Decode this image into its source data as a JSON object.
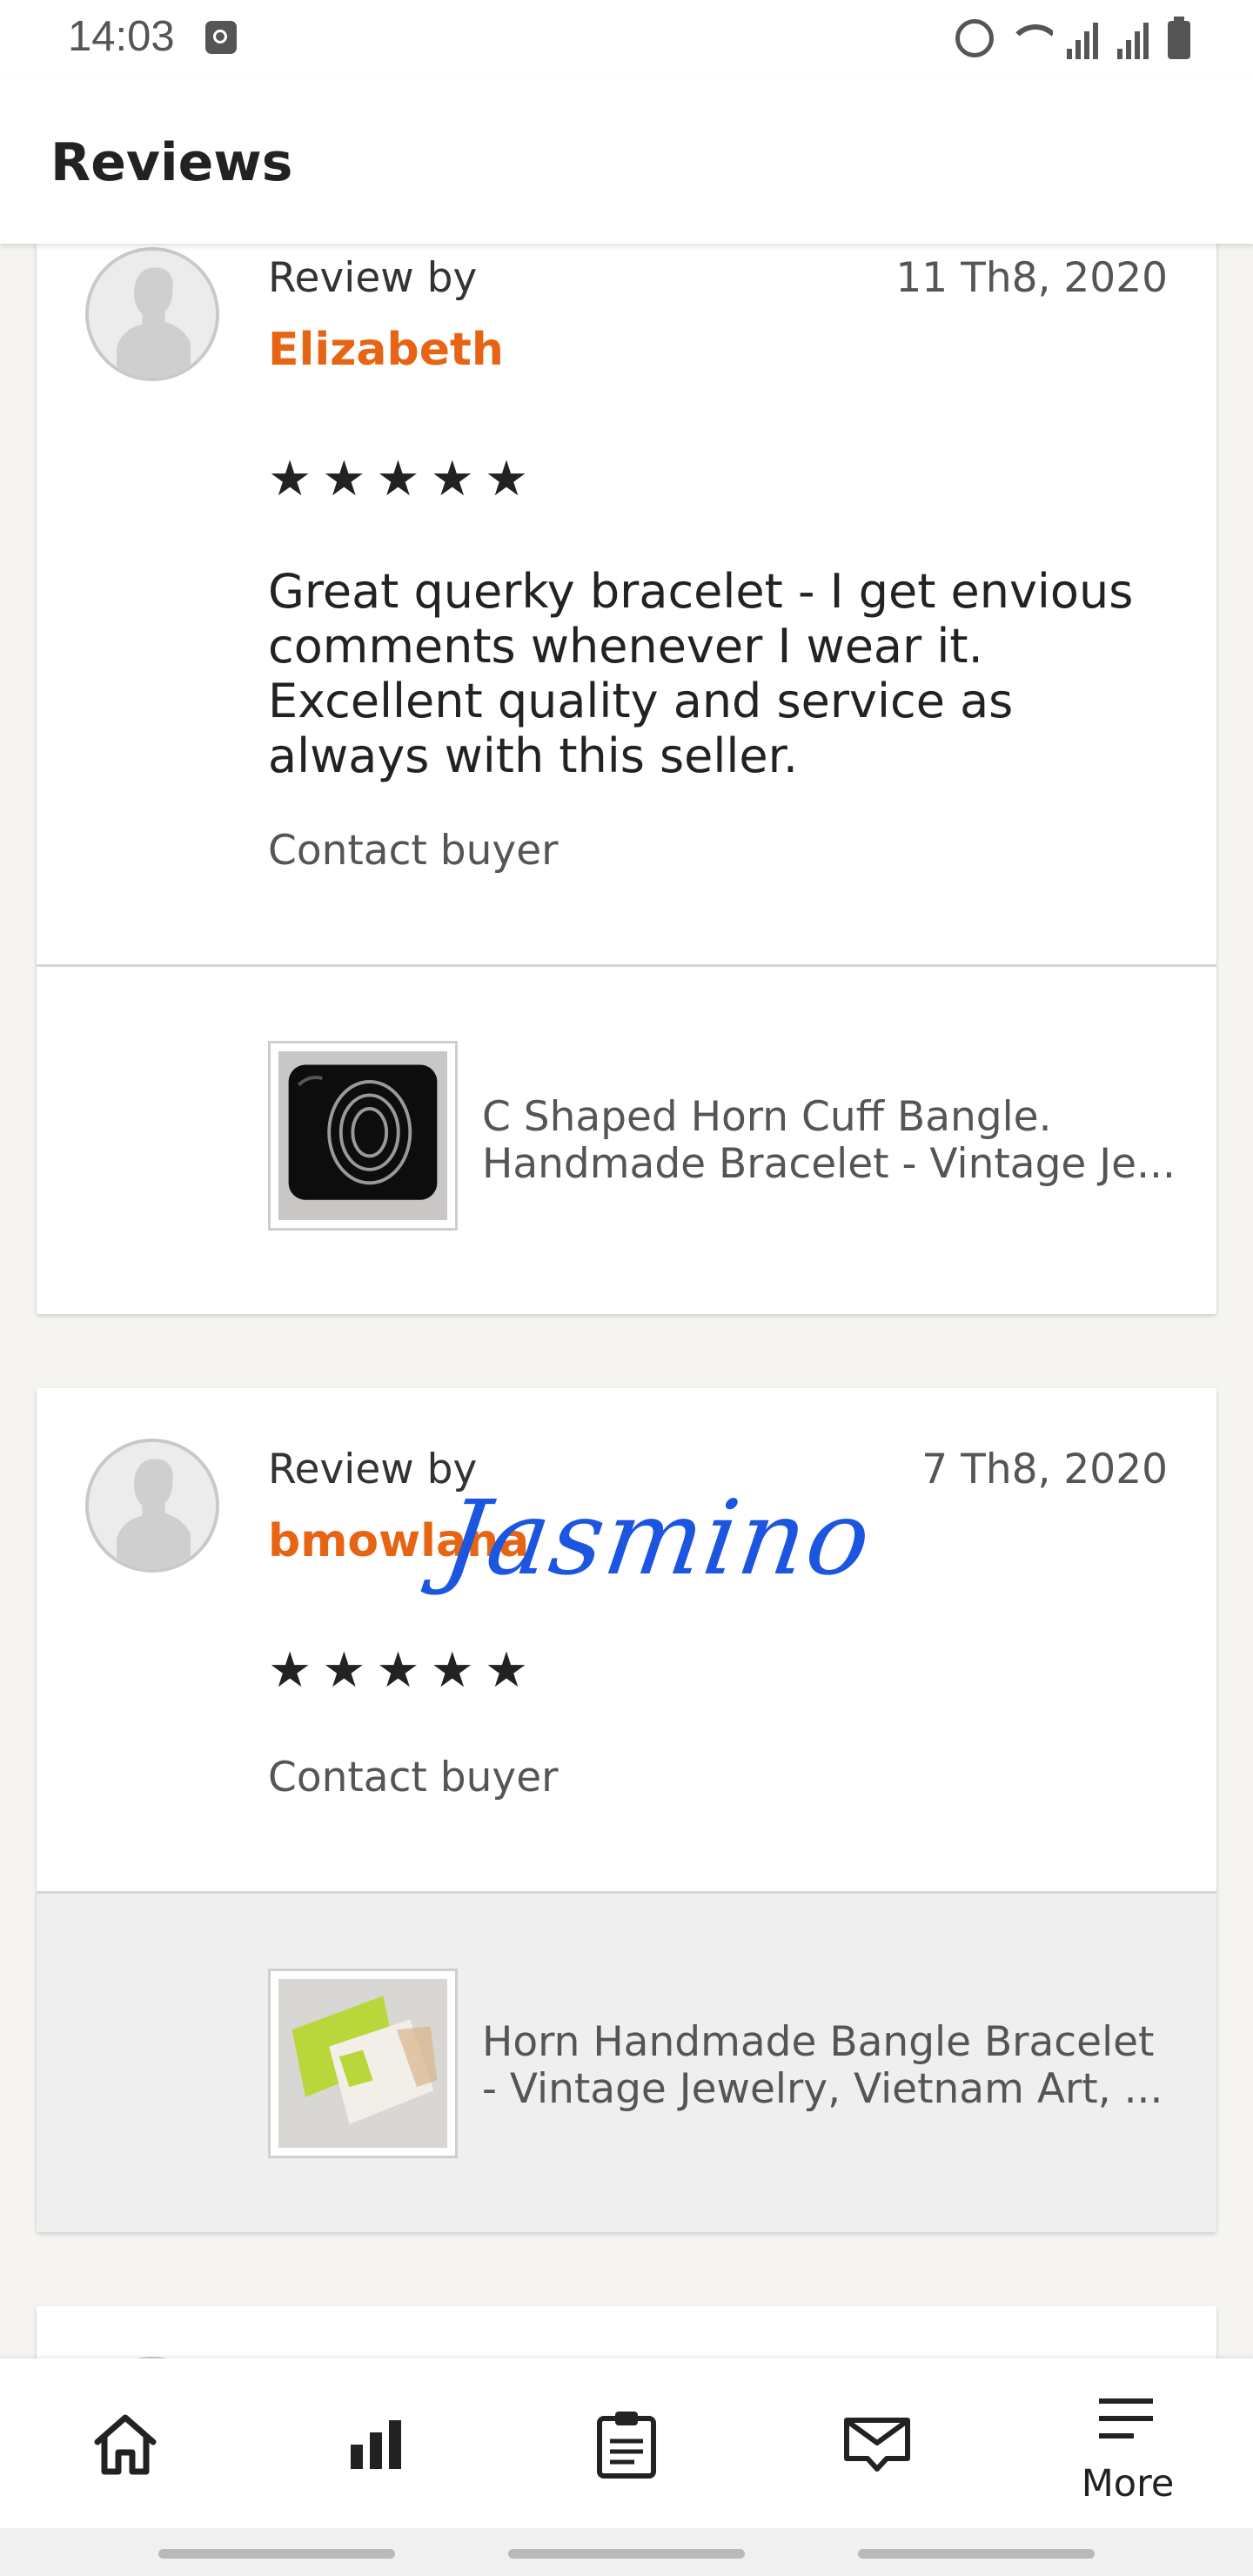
{
  "status_bar": {
    "time": "14:03"
  },
  "header": {
    "title": "Reviews"
  },
  "reviews": [
    {
      "label": "Review by",
      "reviewer": "Elizabeth",
      "date": "11 Th8, 2020",
      "stars": "★★★★★",
      "rating": 5,
      "text": "Great querky bracelet - I get envious comments whenever I wear it. Excellent quality and service as always with this seller.",
      "contact": "Contact buyer",
      "product": {
        "title_line1": "C Shaped Horn Cuff Bangle.",
        "title_line2": "Handmade Bracelet - Vintage Je..."
      }
    },
    {
      "label": "Review by",
      "reviewer": "bmowlana",
      "date": "7 Th8, 2020",
      "stars": "★★★★★",
      "rating": 5,
      "text": "",
      "contact": "Contact buyer",
      "product": {
        "title_line1": "Horn Handmade Bangle Bracelet",
        "title_line2": "- Vintage Jewelry, Vietnam Art, ..."
      }
    }
  ],
  "watermark": "Jasmino",
  "bottom_nav": {
    "items": [
      {
        "icon": "home-icon"
      },
      {
        "icon": "stats-icon"
      },
      {
        "icon": "orders-icon"
      },
      {
        "icon": "messages-icon"
      },
      {
        "icon": "menu-icon",
        "label": "More"
      }
    ]
  },
  "colors": {
    "accent": "#e66414",
    "watermark": "#1b55e0"
  }
}
